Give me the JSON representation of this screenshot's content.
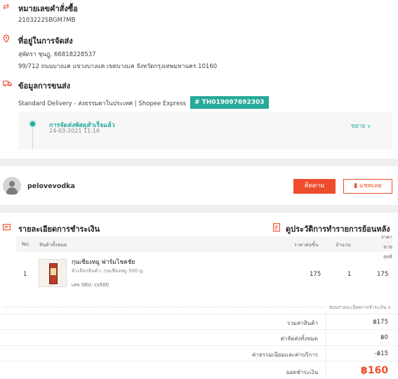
{
  "order": {
    "title": "หมายเลขคำสั่งซื้อ",
    "number": "2103222SBGM7MB"
  },
  "address": {
    "title": "ที่อยู่ในการจัดส่ง",
    "name_phone": "สุพัตรา ชุนฎู, 66818228537",
    "line": "99/712 ถนนบางแค แขวงบางแค เขตบางแค จังหวัดกรุงเทพมหานคร 10160"
  },
  "shipping": {
    "title": "ข้อมูลการขนส่ง",
    "method": "Standard Delivery - ส่งธรรมดาในประเทศ | Shopee Express",
    "tracking": "# TH019097692303",
    "status": "การจัดส่งพัสดุสำเร็จแล้ว",
    "date": "24-03-2021 11:16",
    "expand_label": "ขยาย"
  },
  "seller": {
    "name": "pelovevodka",
    "follow_label": "ติดตาม",
    "chat_label": "แชทเลย"
  },
  "payment": {
    "title": "รายละเอียดการชำระเงิน",
    "history_link": "ดูประวัติการทำรายการย้อนหลัง"
  },
  "table": {
    "headers": {
      "no": "No.",
      "product": "สินค้าทั้งหมด",
      "unit_price": "ราคาต่อชิ้น",
      "qty": "จำนวน",
      "net": "ราคาขาย สุทธิ"
    },
    "rows": [
      {
        "no": "1",
        "name": "กุนเชียงหมู ฟาร์มโชคชัย",
        "variant": "ตัวเลือกสินค้า: กุนเชียงหมู 500 g.",
        "sku": "เลข SKU:  cs500",
        "unit_price": "175",
        "qty": "1",
        "net": "175"
      }
    ]
  },
  "summary": {
    "toggle_label": "ซ่อนรายละเอียดการชำระเงิน",
    "subtotal_label": "รวมค่าสินค้า",
    "subtotal": "฿175",
    "shipping_label": "ค่าจัดส่งทั้งหมด",
    "shipping": "฿0",
    "fee_label": "ค่าธรรมเนียมและค่าบริการ",
    "fee": "-฿15",
    "total_label": "ยอดชำระเงิน",
    "total": "฿160"
  },
  "colors": {
    "brand": "#ee4d2d",
    "teal": "#26aa99"
  }
}
